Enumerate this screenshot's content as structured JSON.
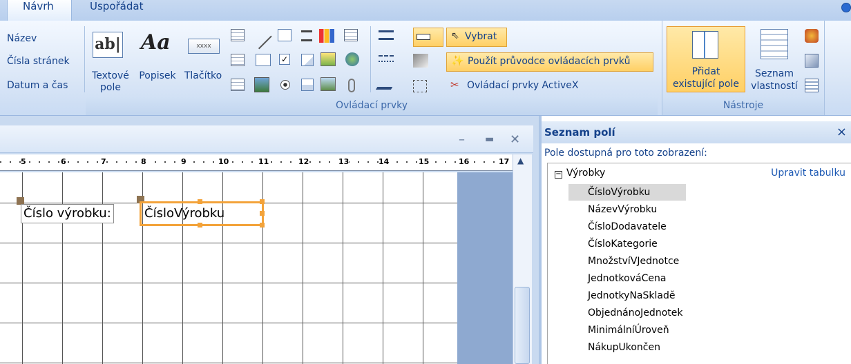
{
  "tabs": [
    {
      "label": "Návrh"
    },
    {
      "label": "Uspořádat"
    }
  ],
  "ribbon": {
    "left_links": {
      "title": "Název",
      "page_numbers": "Čísla stránek",
      "date_time": "Datum a čas"
    },
    "controls": {
      "textbox_label1": "Textové",
      "textbox_label2": "pole",
      "textbox_glyph": "ab|",
      "label_label": "Popisek",
      "label_glyph": "Aa",
      "button_label": "Tlačítko",
      "button_glyph": "xxxx",
      "select_label": "Vybrat",
      "wizard_label": "Použít průvodce ovládacích prvků",
      "activex_label": "Ovládací prvky ActiveX",
      "group_label": "Ovládací prvky"
    },
    "tools": {
      "add_fields_label1": "Přidat",
      "add_fields_label2": "existující pole",
      "props_label1": "Seznam",
      "props_label2": "vlastností",
      "group_label": "Nástroje"
    }
  },
  "editor": {
    "ruler_numbers": [
      "5",
      "6",
      "7",
      "8",
      "9",
      "10",
      "11",
      "12",
      "13",
      "14",
      "15",
      "16",
      "17"
    ],
    "label_control": "Číslo výrobku:",
    "textbox_control": "ČísloVýrobku"
  },
  "field_list": {
    "title": "Seznam polí",
    "close_label": "×",
    "subtitle": "Pole dostupná pro toto zobrazení:",
    "table_name": "Výrobky",
    "edit_link": "Upravit tabulku",
    "fields": [
      "ČísloVýrobku",
      "NázevVýrobku",
      "ČísloDodavatele",
      "ČísloKategorie",
      "MnožstvíVJednotce",
      "JednotkováCena",
      "JednotkyNaSkladě",
      "ObjednánoJednotek",
      "MinimálníÚroveň",
      "NákupUkončen"
    ]
  }
}
